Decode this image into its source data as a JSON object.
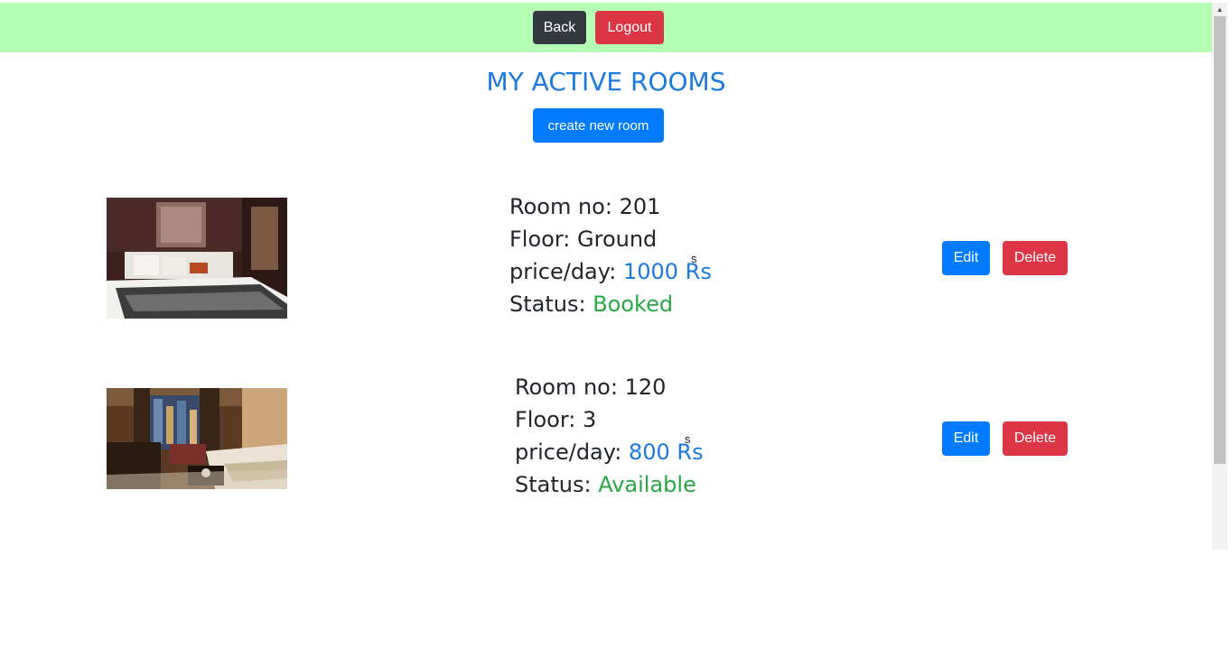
{
  "nav": {
    "back_label": "Back",
    "logout_label": "Logout"
  },
  "page": {
    "title": "MY ACTIVE ROOMS",
    "create_label": "create new room"
  },
  "labels": {
    "room_no": "Room no:",
    "floor": "Floor:",
    "price": "price/day:",
    "status": "Status:",
    "edit": "Edit",
    "delete": "Delete"
  },
  "rooms": [
    {
      "room_no": "201",
      "floor": "Ground",
      "price": "1000 Rs",
      "price_sup": "s",
      "status": "Booked",
      "image": "hotel-bedroom-dark-wood-photo"
    },
    {
      "room_no": "120",
      "floor": "3",
      "price": "800 Rs",
      "price_sup": "s",
      "status": "Available",
      "image": "hotel-room-city-view-photo"
    }
  ],
  "colors": {
    "topbar": "#b5ffb5",
    "title": "#1a7ae0",
    "primary": "#007bff",
    "danger": "#dc3545",
    "dark": "#343a40",
    "success": "#28a745"
  }
}
